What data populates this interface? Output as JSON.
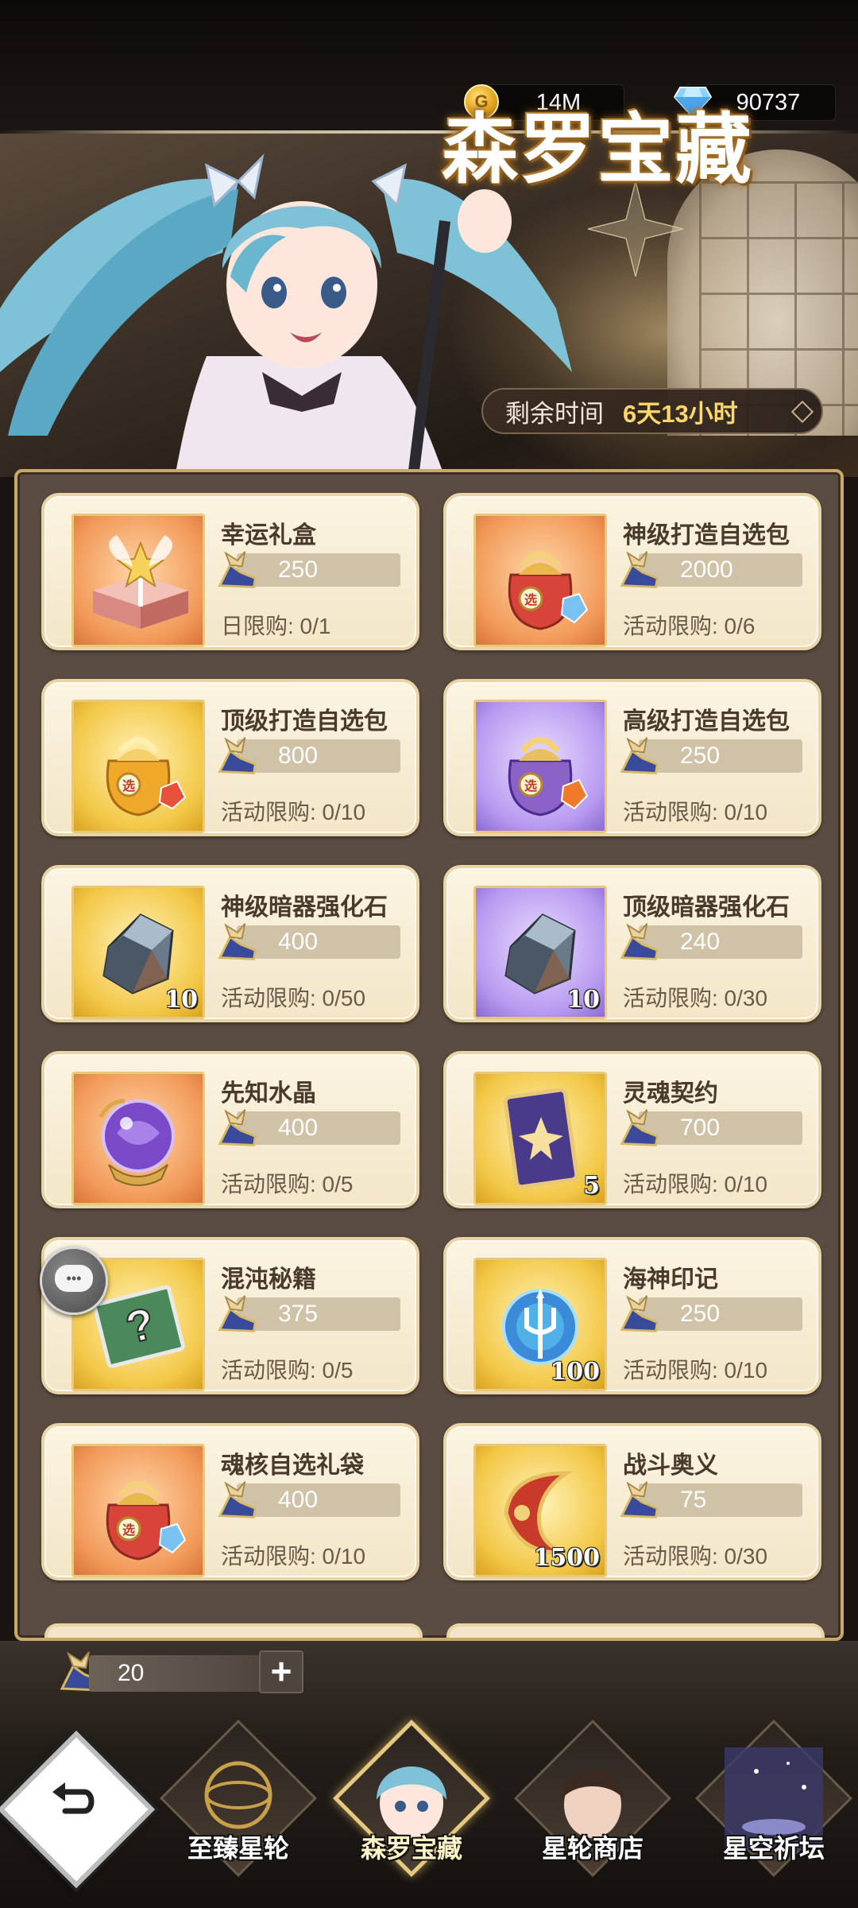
{
  "currency": {
    "gold": "14M",
    "gems": "90737"
  },
  "banner": {
    "title": "森罗宝藏",
    "timer_label": "剩余时间",
    "timer_value": "6天13小时"
  },
  "items": [
    {
      "name": "幸运礼盒",
      "price": "250",
      "limit": "日限购: 0/1",
      "bg": "orange",
      "icon": "gift-box",
      "qty": ""
    },
    {
      "name": "神级打造自选包",
      "price": "2000",
      "limit": "活动限购: 0/6",
      "bg": "orange",
      "icon": "red-bag",
      "qty": ""
    },
    {
      "name": "顶级打造自选包",
      "price": "800",
      "limit": "活动限购: 0/10",
      "bg": "gold",
      "icon": "gold-bag",
      "qty": ""
    },
    {
      "name": "高级打造自选包",
      "price": "250",
      "limit": "活动限购: 0/10",
      "bg": "purple",
      "icon": "purple-bag",
      "qty": ""
    },
    {
      "name": "神级暗器强化石",
      "price": "400",
      "limit": "活动限购: 0/50",
      "bg": "gold",
      "icon": "stone",
      "qty": "10"
    },
    {
      "name": "顶级暗器强化石",
      "price": "240",
      "limit": "活动限购: 0/30",
      "bg": "purple",
      "icon": "stone",
      "qty": "10"
    },
    {
      "name": "先知水晶",
      "price": "400",
      "limit": "活动限购: 0/5",
      "bg": "orange",
      "icon": "crystal-orb",
      "qty": ""
    },
    {
      "name": "灵魂契约",
      "price": "700",
      "limit": "活动限购: 0/10",
      "bg": "gold",
      "icon": "soul-card",
      "qty": "5"
    },
    {
      "name": "混沌秘籍",
      "price": "375",
      "limit": "活动限购: 0/5",
      "bg": "gold",
      "icon": "mystery-book",
      "qty": ""
    },
    {
      "name": "海神印记",
      "price": "250",
      "limit": "活动限购: 0/10",
      "bg": "gold",
      "icon": "trident-orb",
      "qty": "100"
    },
    {
      "name": "魂核自选礼袋",
      "price": "400",
      "limit": "活动限购: 0/10",
      "bg": "orange",
      "icon": "red-bag",
      "qty": ""
    },
    {
      "name": "战斗奥义",
      "price": "75",
      "limit": "活动限购: 0/30",
      "bg": "gold",
      "icon": "horn",
      "qty": "1500"
    }
  ],
  "tokens": {
    "count": "20",
    "plus": "+"
  },
  "nav": [
    {
      "label": "至臻星轮",
      "active": false
    },
    {
      "label": "森罗宝藏",
      "active": true
    },
    {
      "label": "星轮商店",
      "active": false
    },
    {
      "label": "星空祈坛",
      "active": false
    }
  ],
  "colors": {
    "accent": "#ffd76a",
    "card": "#f3e6c8",
    "border": "#c9a86a"
  }
}
